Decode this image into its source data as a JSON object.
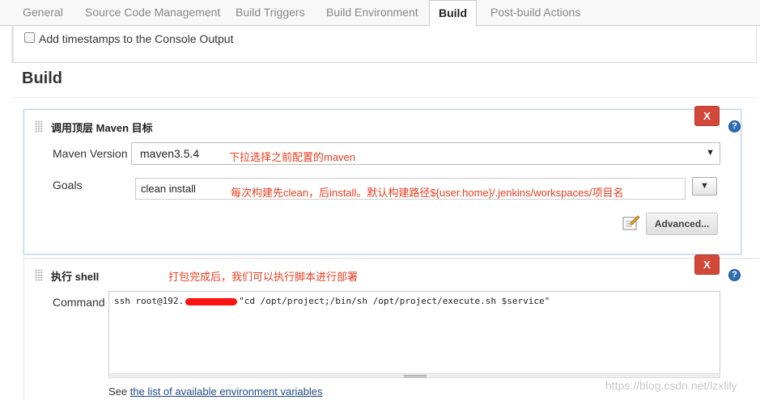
{
  "tabs": [
    "General",
    "Source Code Management",
    "Build Triggers",
    "Build Environment",
    "Build",
    "Post-build Actions"
  ],
  "active_tab": "Build",
  "timestamps_label": "Add timestamps to the Console Output",
  "section_title": "Build",
  "maven": {
    "title": "调用顶层 Maven 目标",
    "version_label": "Maven Version",
    "version_value": "maven3.5.4",
    "version_note": "下拉选择之前配置的maven",
    "goals_label": "Goals",
    "goals_value": "clean install",
    "goals_note": "每次构建先clean，后install。默认构建路径${user.home}/.jenkins/workspaces/项目名",
    "advanced_label": "Advanced...",
    "delete_label": "X",
    "help_label": "?"
  },
  "shell": {
    "title": "执行 shell",
    "note": "打包完成后，我们可以执行脚本进行部署",
    "command_label": "Command",
    "command_prefix": "ssh root@192.",
    "command_suffix": "\"cd /opt/project;/bin/sh /opt/project/execute.sh $service\"",
    "see_prefix": "See ",
    "see_link": "the list of available environment variables",
    "delete_label": "X",
    "help_label": "?"
  },
  "watermark": "https://blog.csdn.net/lzxlily"
}
